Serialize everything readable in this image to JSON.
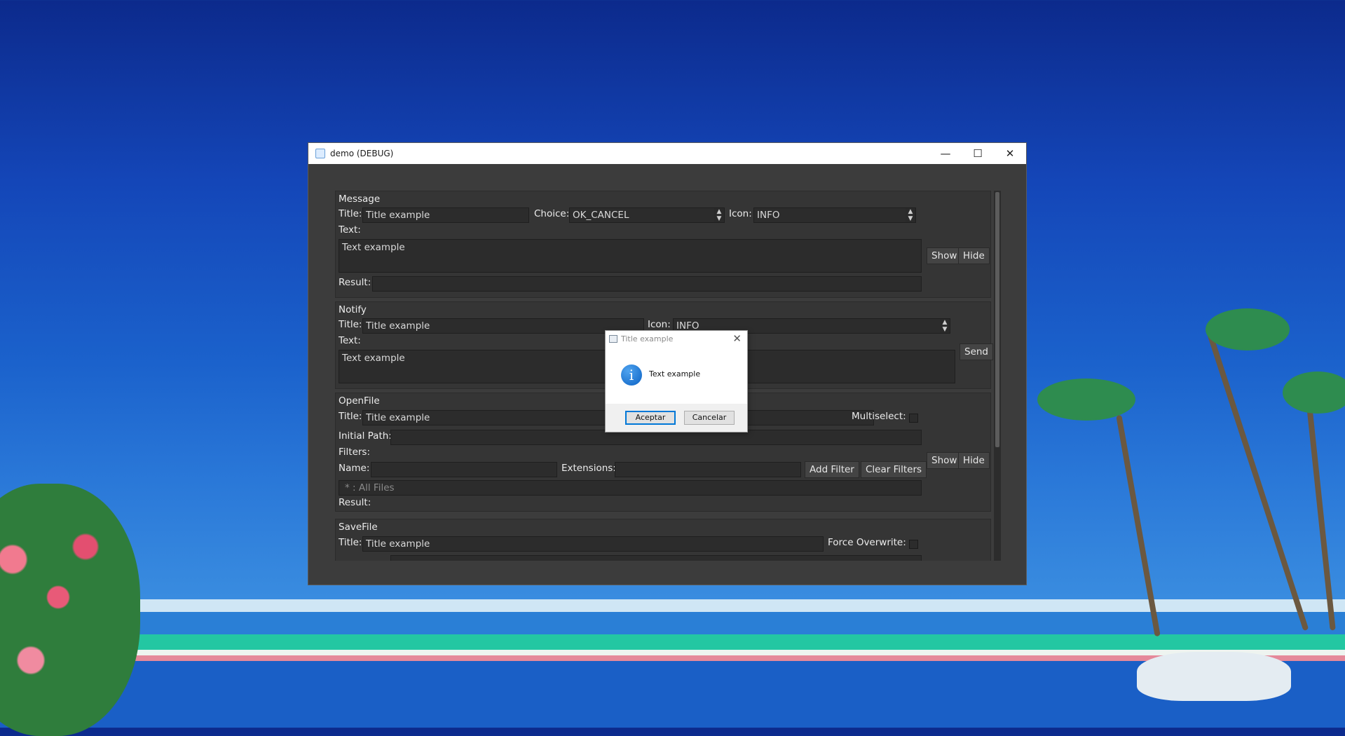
{
  "window": {
    "title": "demo (DEBUG)"
  },
  "message": {
    "header": "Message",
    "title_label": "Title:",
    "title_value": "Title example",
    "choice_label": "Choice:",
    "choice_value": "OK_CANCEL",
    "icon_label": "Icon:",
    "icon_value": "INFO",
    "text_label": "Text:",
    "text_value": "Text example",
    "result_label": "Result:",
    "show_label": "Show",
    "hide_label": "Hide"
  },
  "notify": {
    "header": "Notify",
    "title_label": "Title:",
    "title_value": "Title example",
    "icon_label": "Icon:",
    "icon_value": "INFO",
    "text_label": "Text:",
    "text_value": "Text example",
    "send_label": "Send"
  },
  "openfile": {
    "header": "OpenFile",
    "title_label": "Title:",
    "title_value": "Title example",
    "multiselect_label": "Multiselect:",
    "initial_path_label": "Initial Path:",
    "filters_label": "Filters:",
    "name_label": "Name:",
    "extensions_label": "Extensions:",
    "add_filter_label": "Add Filter",
    "clear_filters_label": "Clear Filters",
    "filters_placeholder": "* : All Files",
    "result_label": "Result:",
    "show_label": "Show",
    "hide_label": "Hide"
  },
  "savefile": {
    "header": "SaveFile",
    "title_label": "Title:",
    "title_value": "Title example",
    "force_overwrite_label": "Force Overwrite:"
  },
  "dialog": {
    "title": "Title example",
    "message": "Text example",
    "icon": "info-icon",
    "ok_label": "Aceptar",
    "cancel_label": "Cancelar"
  }
}
